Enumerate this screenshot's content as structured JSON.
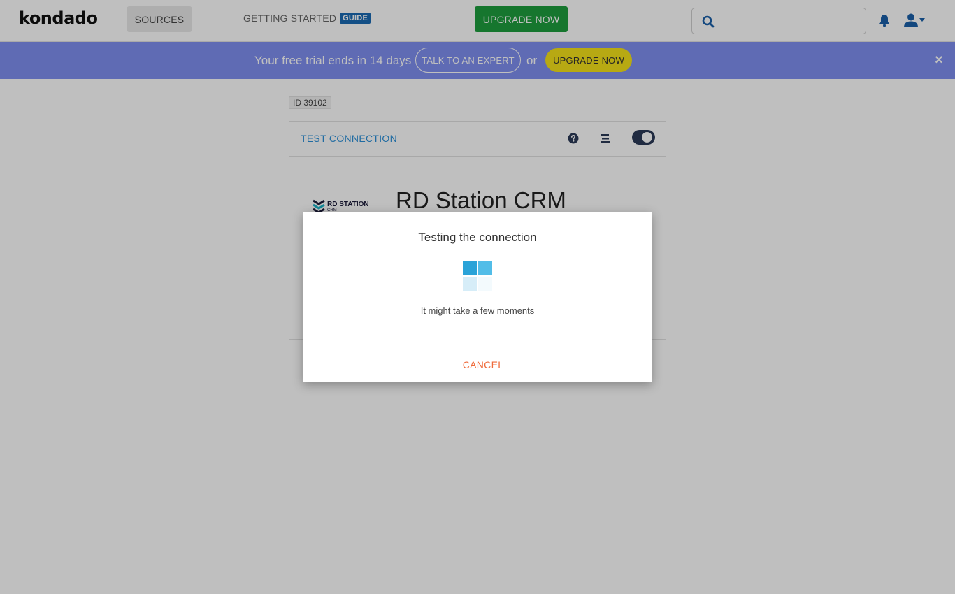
{
  "nav": {
    "logo": "kondado",
    "sources": "SOURCES",
    "getting_started": "GETTING STARTED",
    "guide_badge": "GUIDE",
    "upgrade": "UPGRADE NOW",
    "search_placeholder": "",
    "icons": [
      "search-icon",
      "bell-icon",
      "user-icon",
      "caret-down-icon"
    ]
  },
  "banner": {
    "text": "Your free trial ends in 14 days",
    "talk_expert": "TALK TO AN EXPERT",
    "or": "or",
    "upgrade": "UPGRADE NOW",
    "close": "×"
  },
  "main": {
    "id_badge": "ID 39102",
    "card": {
      "test_connection": "TEST CONNECTION",
      "title": "RD Station CRM",
      "logo_text": "RD STATION",
      "logo_sub": "CRM",
      "toggle_on": true
    }
  },
  "modal": {
    "title": "Testing the connection",
    "subtitle": "It might take a few moments",
    "cancel": "CANCEL"
  },
  "colors": {
    "upgrade_green": "#1e9e3e",
    "banner_purple": "#7f8ff0",
    "upgrade_yellow": "#f5e21a",
    "link_blue": "#2a8fd8",
    "cancel_orange": "#ef6a3a"
  }
}
